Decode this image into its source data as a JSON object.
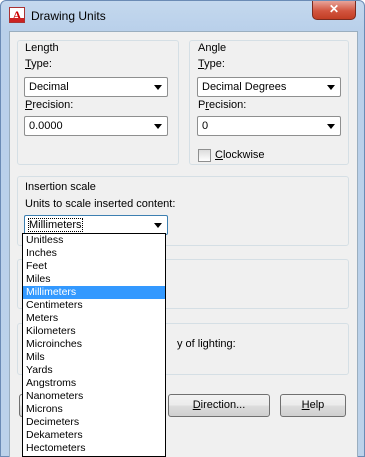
{
  "window": {
    "title": "Drawing Units",
    "close_glyph": "✕"
  },
  "length": {
    "group_label": "Length",
    "type_label": "Type:",
    "type_value": "Decimal",
    "precision_label": "Precision:",
    "precision_value": "0.0000"
  },
  "angle": {
    "group_label": "Angle",
    "type_label": "Type:",
    "type_value": "Decimal Degrees",
    "precision_label": "Precision:",
    "precision_value": "0",
    "clockwise_label": "Clockwise",
    "clockwise_checked": false
  },
  "insertion": {
    "group_label": "Insertion scale",
    "units_label": "Units to scale inserted content:",
    "units_value": "Millimeters",
    "options": [
      "Unitless",
      "Inches",
      "Feet",
      "Miles",
      "Millimeters",
      "Centimeters",
      "Meters",
      "Kilometers",
      "Microinches",
      "Mils",
      "Yards",
      "Angstroms",
      "Nanometers",
      "Microns",
      "Decimeters",
      "Dekameters",
      "Hectometers"
    ],
    "selected_index": 4
  },
  "lighting": {
    "label_fragment": "y of lighting:"
  },
  "buttons": {
    "direction": "Direction...",
    "help": "Help"
  }
}
